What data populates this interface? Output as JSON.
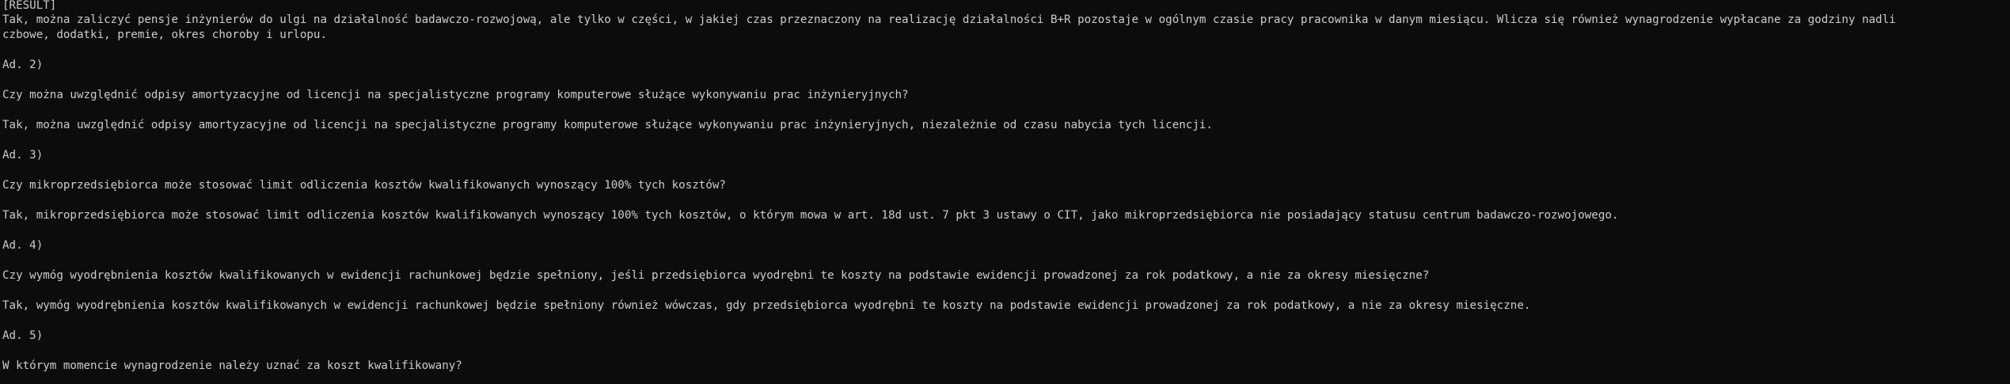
{
  "terminal": {
    "lines": [
      "[RESULT]",
      "Tak, można zaliczyć pensje inżynierów do ulgi na działalność badawczo-rozwojową, ale tylko w części, w jakiej czas przeznaczony na realizację działalności B+R pozostaje w ogólnym czasie pracy pracownika w danym miesiącu. Wlicza się również wynagrodzenie wypłacane za godziny nadli",
      "czbowe, dodatki, premie, okres choroby i urlopu.",
      "Ad. 2)",
      "Czy można uwzględnić odpisy amortyzacyjne od licencji na specjalistyczne programy komputerowe służące wykonywaniu prac inżynieryjnych?",
      "Tak, można uwzględnić odpisy amortyzacyjne od licencji na specjalistyczne programy komputerowe służące wykonywaniu prac inżynieryjnych, niezależnie od czasu nabycia tych licencji.",
      "Ad. 3)",
      "Czy mikroprzedsiębiorca może stosować limit odliczenia kosztów kwalifikowanych wynoszący 100% tych kosztów?",
      "Tak, mikroprzedsiębiorca może stosować limit odliczenia kosztów kwalifikowanych wynoszący 100% tych kosztów, o którym mowa w art. 18d ust. 7 pkt 3 ustawy o CIT, jako mikroprzedsiębiorca nie posiadający statusu centrum badawczo-rozwojowego.",
      "Ad. 4)",
      "Czy wymóg wyodrębnienia kosztów kwalifikowanych w ewidencji rachunkowej będzie spełniony, jeśli przedsiębiorca wyodrębni te koszty na podstawie ewidencji prowadzonej za rok podatkowy, a nie za okresy miesięczne?",
      "Tak, wymóg wyodrębnienia kosztów kwalifikowanych w ewidencji rachunkowej będzie spełniony również wówczas, gdy przedsiębiorca wyodrębni te koszty na podstawie ewidencji prowadzonej za rok podatkowy, a nie za okresy miesięczne.",
      "Ad. 5)",
      "W którym momencie wynagrodzenie należy uznać za koszt kwalifikowany?"
    ]
  }
}
